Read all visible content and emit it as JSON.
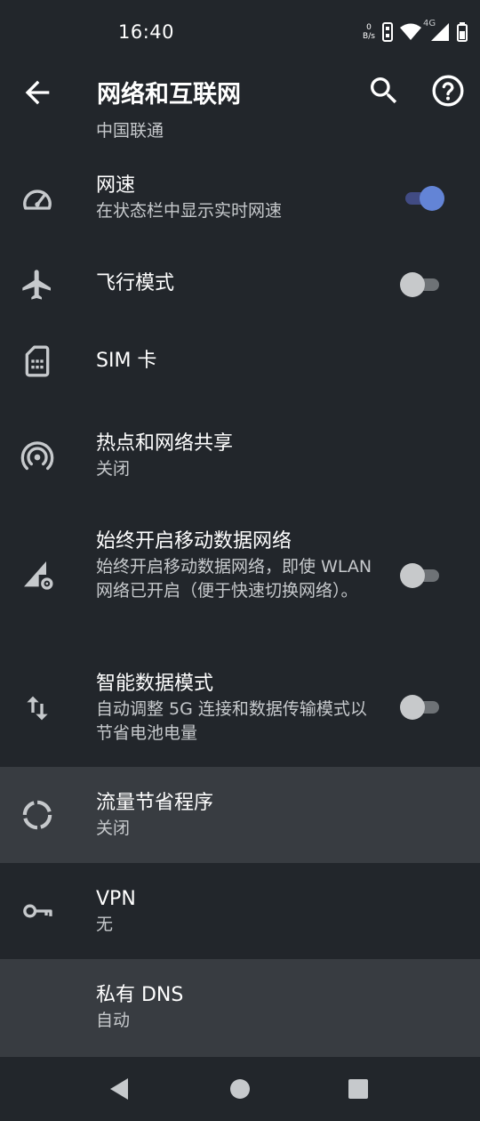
{
  "status": {
    "time": "16:40",
    "netspeed_value": "0",
    "netspeed_unit": "B/s",
    "network_type": "4G",
    "icons": [
      "hd-icon",
      "wifi-icon",
      "cell-signal-icon",
      "battery-icon"
    ]
  },
  "header": {
    "title": "网络和互联网",
    "back_icon": "arrow-back-icon",
    "search_icon": "search-icon",
    "help_icon": "help-icon"
  },
  "items": [
    {
      "subtitle": "中国联通",
      "icon": "sim-signal-icon"
    },
    {
      "title": "网速",
      "subtitle": "在状态栏中显示实时网速",
      "icon": "speedometer-icon",
      "toggle": true
    },
    {
      "title": "飞行模式",
      "icon": "airplane-icon",
      "toggle": false
    },
    {
      "title": "SIM 卡",
      "icon": "sim-card-icon"
    },
    {
      "title": "热点和网络共享",
      "subtitle": "关闭",
      "icon": "hotspot-icon"
    },
    {
      "title": "始终开启移动数据网络",
      "subtitle": "始终开启移动数据网络，即使 WLAN 网络已开启（便于快速切换网络）。",
      "icon": "mobile-data-settings-icon",
      "toggle": false
    },
    {
      "title": "智能数据模式",
      "subtitle": "自动调整 5G 连接和数据传输模式以节省电池电量",
      "icon": "swap-arrows-icon",
      "toggle": false
    },
    {
      "title": "流量节省程序",
      "subtitle": "关闭",
      "icon": "data-saver-icon"
    },
    {
      "title": "VPN",
      "subtitle": "无",
      "icon": "key-icon"
    },
    {
      "title": "私有 DNS",
      "subtitle": "自动"
    }
  ],
  "navbar": {
    "icons": [
      "nav-back-icon",
      "nav-home-icon",
      "nav-recents-icon"
    ]
  },
  "colors": {
    "background": "#22262b",
    "highlight_row": "#383c41",
    "accent": "#6384d6",
    "secondary_text": "#c6c9cc"
  }
}
